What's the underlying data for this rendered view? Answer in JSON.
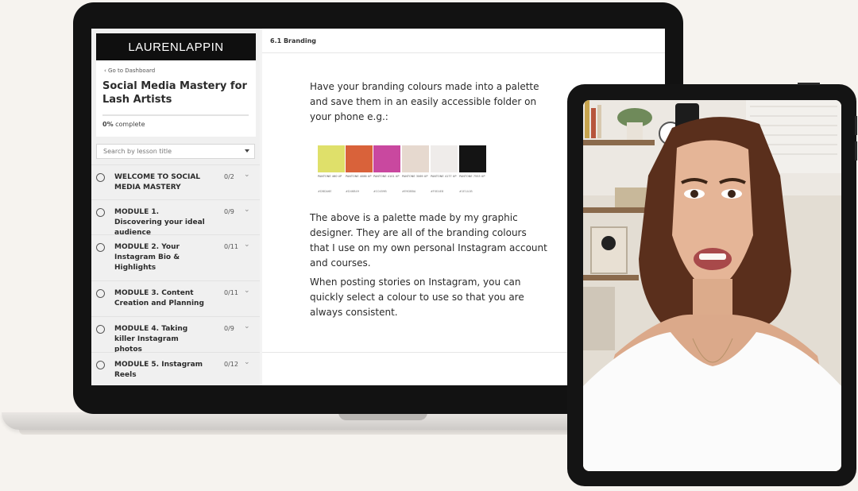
{
  "sidebar": {
    "brand": "LAURENLAPPIN",
    "back_link": "‹ Go to Dashboard",
    "course_title": "Social Media Mastery for Lash Artists",
    "progress_percent": "0%",
    "progress_suffix": " complete",
    "search_placeholder": "Search by lesson title",
    "modules": [
      {
        "title": "WELCOME TO SOCIAL MEDIA MASTERY",
        "count": "0/2"
      },
      {
        "title": "MODULE 1. Discovering your ideal audience",
        "count": "0/9"
      },
      {
        "title": "MODULE 2. Your Instagram Bio & Highlights",
        "count": "0/11"
      },
      {
        "title": "MODULE 3. Content Creation and Planning",
        "count": "0/11"
      },
      {
        "title": "MODULE 4. Taking killer Instagram photos",
        "count": "0/9"
      },
      {
        "title": "MODULE 5. Instagram Reels",
        "count": "0/12"
      }
    ]
  },
  "content": {
    "breadcrumb": "6.1 Branding",
    "para1": "Have your branding colours made into a palette and save them in an easily accessible folder on your phone e.g.:",
    "para2": "The above is a palette made by my graphic designer. They are all of the branding colours that I use on my own personal Instagram account and courses.",
    "para3": "When posting stories on Instagram, you can quickly select a colour to use so that you are always consistent.",
    "palette": [
      {
        "color": "#dfe06a",
        "label": "PANTONE 460 UP",
        "hex": "#DBDA6E"
      },
      {
        "color": "#d9623a",
        "label": "PANTONE 4086 UP",
        "hex": "#D46B49"
      },
      {
        "color": "#c9489f",
        "label": "PANTONE 4101 UP",
        "hex": "#C0459B"
      },
      {
        "color": "#e6d9cf",
        "label": "PANTONE 3069 UP",
        "hex": "#E9DBBA"
      },
      {
        "color": "#efecea",
        "label": "PANTONE 4177 UP",
        "hex": "#F0EAE8"
      },
      {
        "color": "#141414",
        "label": "PANTONE 7553 UP",
        "hex": "#1E1A1B"
      }
    ]
  }
}
